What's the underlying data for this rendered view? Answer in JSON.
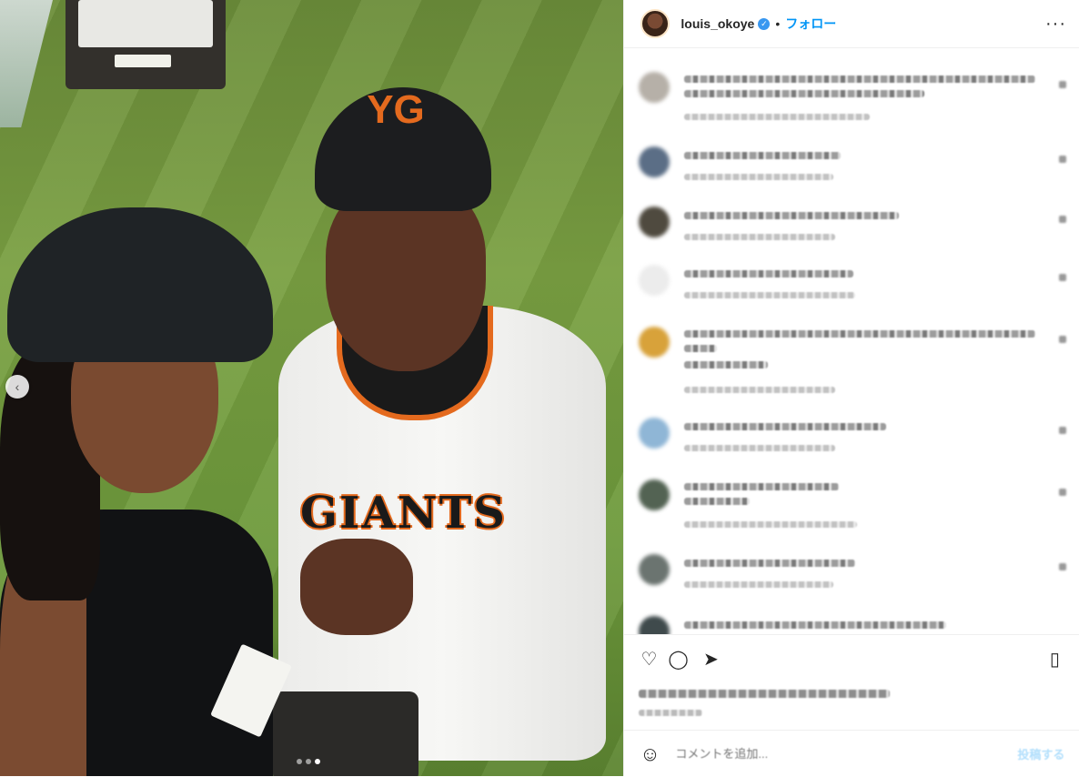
{
  "photo": {
    "jersey_text": "GIANTS",
    "cap_logo": "YG",
    "carousel_prev_icon": "chevron-left-icon",
    "slides": 3,
    "active_slide": 3
  },
  "header": {
    "username": "louis_okoye",
    "verified_icon": "verified-badge-icon",
    "separator": "•",
    "follow_label": "フォロー",
    "more_icon": "more-options-icon"
  },
  "comments": {
    "count": 9,
    "note": "comment text is pixelated/blurred in the screenshot"
  },
  "actions": {
    "like_icon": "heart-icon",
    "comment_icon": "comment-icon",
    "share_icon": "share-icon",
    "save_icon": "bookmark-icon"
  },
  "add_comment": {
    "emoji_icon": "emoji-icon",
    "placeholder": "コメントを追加...",
    "post_label": "投稿する"
  },
  "colors": {
    "accent": "#0095f6",
    "verified": "#3897f0",
    "post_disabled": "#b2dffc"
  }
}
